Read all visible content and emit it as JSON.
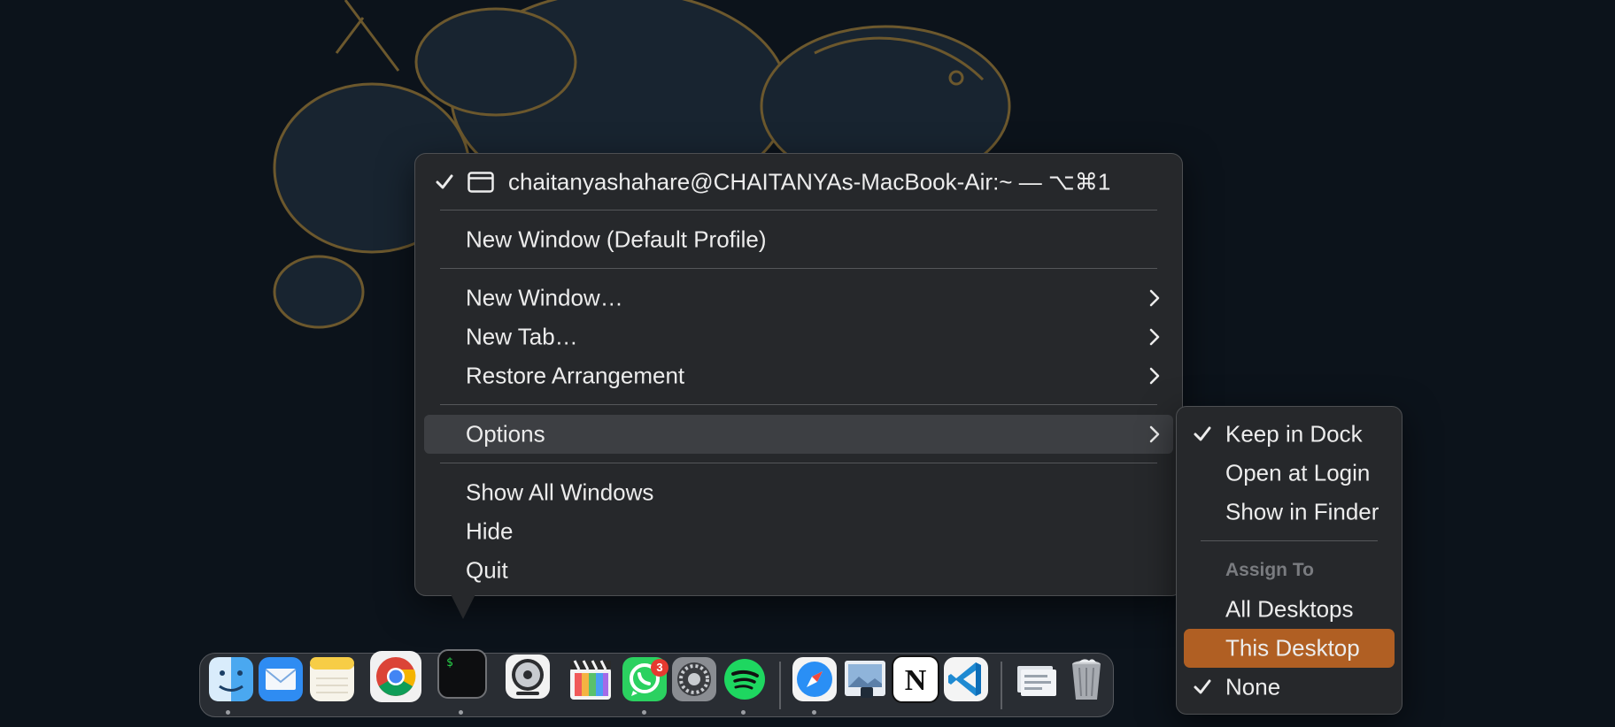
{
  "context_menu": {
    "window_item": {
      "label": "chaitanyashahare@CHAITANYAs-MacBook-Air:~ — ⌥⌘1",
      "checked": true
    },
    "items": [
      {
        "label": "New Window (Default Profile)"
      },
      {
        "label": "New Window…",
        "submenu": true
      },
      {
        "label": "New Tab…",
        "submenu": true
      },
      {
        "label": "Restore Arrangement",
        "submenu": true
      },
      {
        "label": "Options",
        "submenu": true,
        "highlighted": true
      },
      {
        "label": "Show All Windows"
      },
      {
        "label": "Hide"
      },
      {
        "label": "Quit"
      }
    ]
  },
  "options_submenu": {
    "items": [
      {
        "label": "Keep in Dock",
        "checked": true
      },
      {
        "label": "Open at Login"
      },
      {
        "label": "Show in Finder"
      }
    ],
    "assign_header": "Assign To",
    "assign_items": [
      {
        "label": "All Desktops"
      },
      {
        "label": "This Desktop",
        "selected": true
      },
      {
        "label": "None",
        "checked": true
      }
    ]
  },
  "dock": {
    "apps": [
      {
        "name": "finder-icon",
        "running": true
      },
      {
        "name": "mail-icon",
        "running": false
      },
      {
        "name": "notes-icon",
        "running": false
      },
      {
        "name": "chrome-icon",
        "running": false
      },
      {
        "name": "terminal-icon",
        "running": true
      },
      {
        "name": "logic-icon",
        "running": false
      },
      {
        "name": "final-cut-icon",
        "running": false
      },
      {
        "name": "whatsapp-icon",
        "running": true,
        "badge": "3"
      },
      {
        "name": "system-settings-icon",
        "running": false
      },
      {
        "name": "spotify-icon",
        "running": true
      },
      {
        "name": "safari-icon",
        "running": true
      },
      {
        "name": "preview-icon",
        "running": false
      },
      {
        "name": "notion-icon",
        "running": false
      },
      {
        "name": "vscode-icon",
        "running": false
      },
      {
        "name": "downloads-stack-icon",
        "running": false
      },
      {
        "name": "trash-icon",
        "running": false
      }
    ],
    "terminal_glyph": "$",
    "notion_glyph": "N"
  },
  "colors": {
    "menu_bg": "#26282b",
    "highlight": "#3d3f43",
    "selected_accent": "#b05f23",
    "wallpaper_bg": "#0c131b",
    "wallpaper_art": "#9a7a3a"
  }
}
